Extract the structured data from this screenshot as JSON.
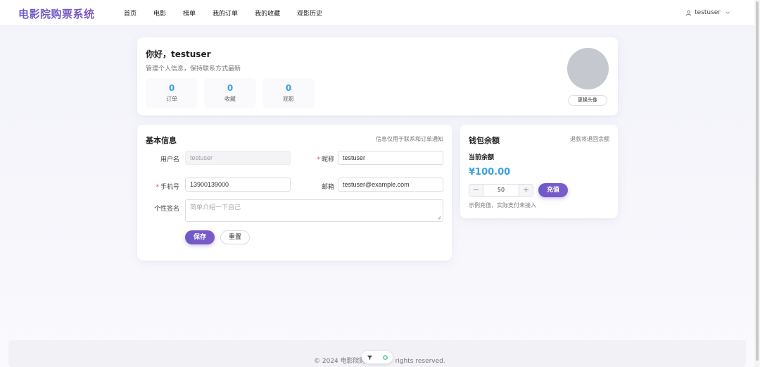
{
  "header": {
    "logo": "电影院购票系统",
    "nav": [
      "首页",
      "电影",
      "榜单",
      "我的订单",
      "我的收藏",
      "观影历史"
    ],
    "username": "testuser"
  },
  "profile": {
    "greeting": "你好，testuser",
    "subtitle": "管理个人信息，保持联系方式最新",
    "stats": [
      {
        "value": "0",
        "label": "订单"
      },
      {
        "value": "0",
        "label": "收藏"
      },
      {
        "value": "0",
        "label": "观影"
      }
    ],
    "change_avatar_label": "更换头像"
  },
  "basic_info": {
    "title": "基本信息",
    "hint": "信息仅用于联系和订单通知",
    "username_label": "用户名",
    "username_value": "testuser",
    "nickname_label": "昵称",
    "nickname_value": "testuser",
    "phone_label": "手机号",
    "phone_value": "13900139000",
    "email_label": "邮箱",
    "email_value": "testuser@example.com",
    "signature_label": "个性签名",
    "signature_placeholder": "简单介绍一下自己",
    "save_label": "保存",
    "reset_label": "重置"
  },
  "wallet": {
    "title": "钱包余额",
    "hint": "退款将退回余额",
    "current_label": "当前余额",
    "amount": "¥100.00",
    "minus": "−",
    "plus": "+",
    "recharge_value": "50",
    "recharge_label": "充值",
    "note": "示例充值，实际支付未接入"
  },
  "footer": {
    "text_left": "© 2024 电影院购",
    "text_right": "rights reserved."
  },
  "colors": {
    "accent": "#6e59c9",
    "stat_blue": "#3aa0e0",
    "required": "#e5484d"
  }
}
